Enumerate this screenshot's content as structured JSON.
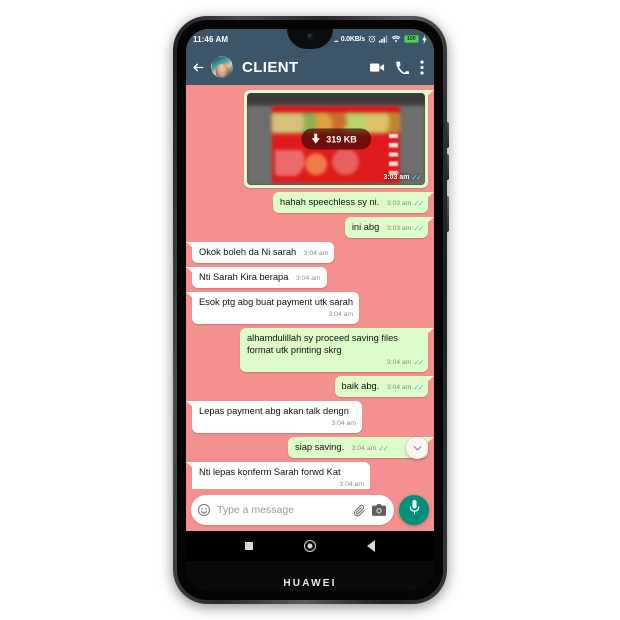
{
  "device": {
    "brand": "HUAWEI"
  },
  "statusbar": {
    "time": "11:46 AM",
    "leading_dots": "...",
    "network_speed": "0.0KB/s",
    "alarm_icon": "alarm-icon",
    "signal_icon": "cellular-signal-icon",
    "wifi_icon": "wifi-icon",
    "battery_level": "100",
    "charging_icon": "charging-bolt-icon"
  },
  "appbar": {
    "back_icon": "back-arrow-icon",
    "avatar": "contact-avatar",
    "title": "CLIENT",
    "video_call_icon": "video-call-icon",
    "voice_call_icon": "phone-call-icon",
    "overflow_icon": "more-vert-icon"
  },
  "theme": {
    "chat_background": "#f4918e",
    "appbar_background": "#3c5568",
    "outgoing_bubble": "#ddfcc9",
    "incoming_bubble": "#ffffff",
    "tick_color": "#34b7f1",
    "mic_button": "#00917a"
  },
  "messages": [
    {
      "id": "msg-image",
      "direction": "out",
      "type": "image",
      "download_label": "319 KB",
      "download_icon": "download-arrow-icon",
      "time": "3:03 am",
      "status": "read"
    },
    {
      "id": "msg-1",
      "direction": "out",
      "type": "text",
      "text": "hahah speechless sy ni.",
      "time": "3:03 am",
      "status": "read",
      "meta_inline": true
    },
    {
      "id": "msg-2",
      "direction": "out",
      "type": "text",
      "text": "ini abg",
      "time": "3:03 am",
      "status": "read",
      "meta_inline": true
    },
    {
      "id": "msg-3",
      "direction": "in",
      "type": "text",
      "text": "Okok boleh da Ni sarah",
      "time": "3:04 am",
      "status": "none",
      "meta_inline": true
    },
    {
      "id": "msg-4",
      "direction": "in",
      "type": "text",
      "text": "Nti Sarah Kira berapa",
      "time": "3:04 am",
      "status": "none",
      "meta_inline": true
    },
    {
      "id": "msg-5",
      "direction": "in",
      "type": "text",
      "text": "Esok ptg abg buat payment utk sarah",
      "time": "3:04 am",
      "status": "none",
      "meta_inline": false
    },
    {
      "id": "msg-6",
      "direction": "out",
      "type": "text",
      "text": "alhamdulillah sy proceed saving files format utk printing skrg",
      "time": "3:04 am",
      "status": "read",
      "meta_inline": false
    },
    {
      "id": "msg-7",
      "direction": "out",
      "type": "text",
      "text": "baik abg.",
      "time": "3:04 am",
      "status": "read",
      "meta_inline": true
    },
    {
      "id": "msg-8",
      "direction": "in",
      "type": "text",
      "text": "Lepas payment abg akan talk dengn",
      "time": "3:04 am",
      "status": "none",
      "meta_inline": false
    },
    {
      "id": "msg-9",
      "direction": "out",
      "type": "text",
      "text": "siap saving.",
      "time": "3:04 am",
      "status": "read",
      "meta_inline": true
    },
    {
      "id": "msg-10",
      "direction": "in",
      "type": "text",
      "text": "Nti lepas konferm Sarah forwd Kat",
      "time": "3:04 am",
      "status": "none",
      "meta_inline": false
    }
  ],
  "scroll_fab": {
    "icon": "chevron-double-down-icon"
  },
  "composer": {
    "emoji_icon": "emoji-smiley-icon",
    "placeholder": "Type a message",
    "value": "",
    "attach_icon": "paperclip-icon",
    "camera_icon": "camera-icon",
    "mic_icon": "microphone-icon"
  },
  "navbar": {
    "recents_icon": "recents-square-icon",
    "home_icon": "home-circle-icon",
    "back_icon": "back-triangle-icon"
  }
}
